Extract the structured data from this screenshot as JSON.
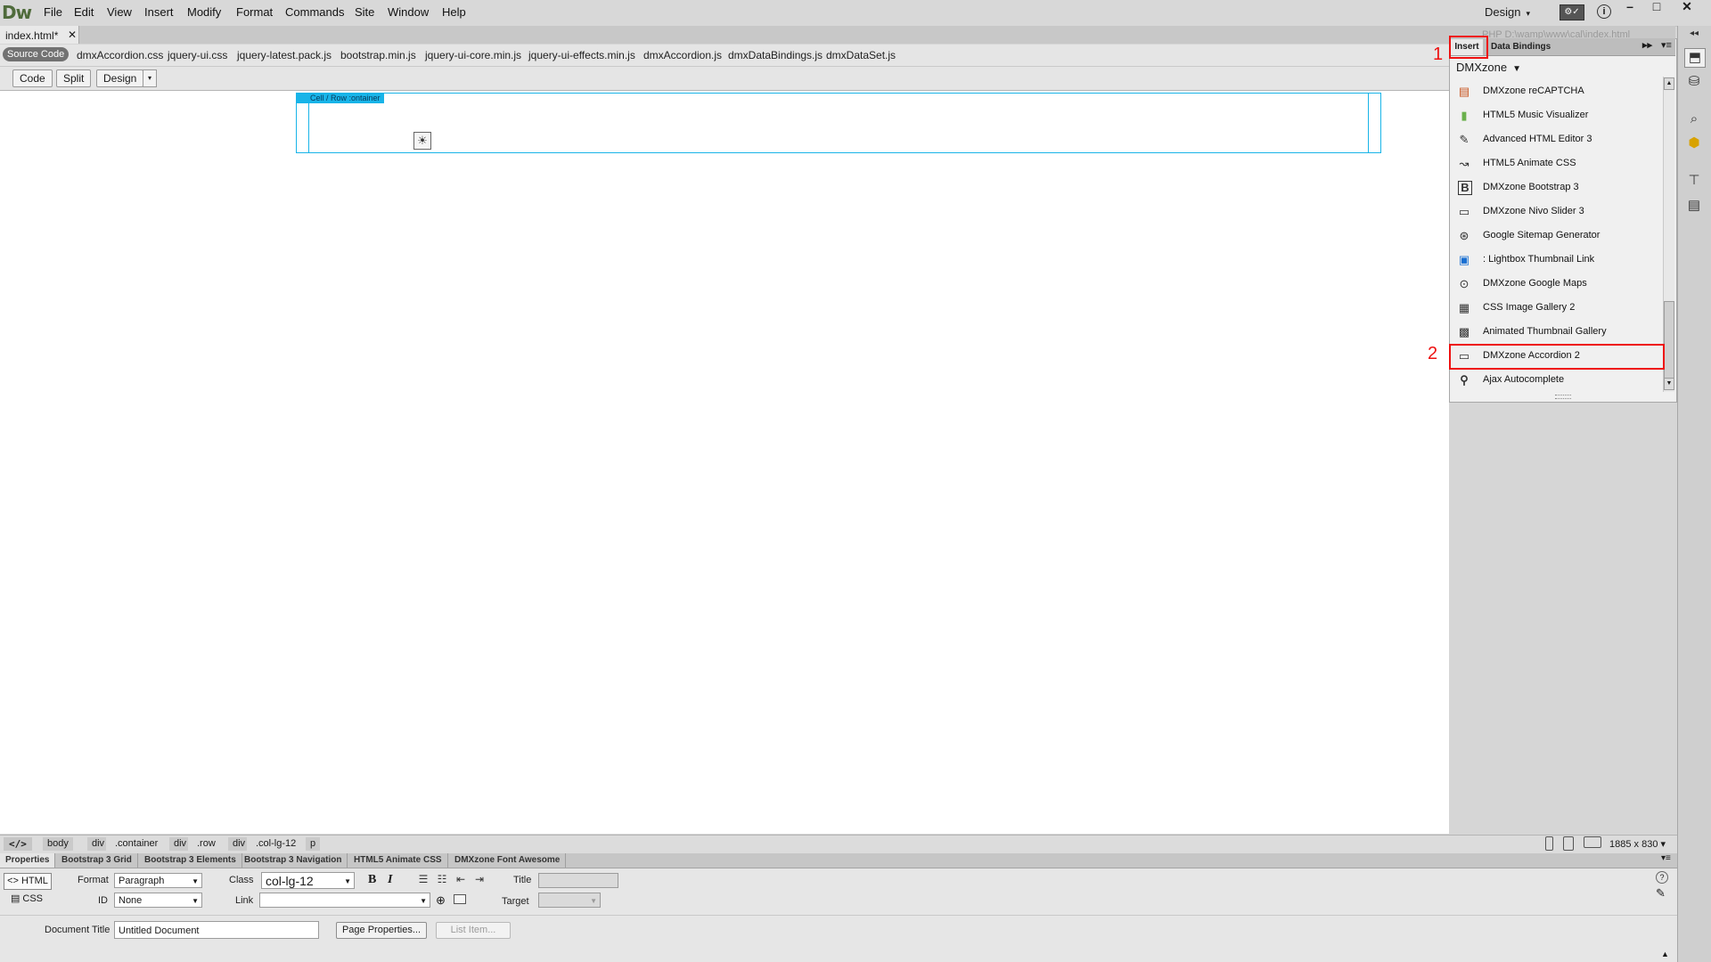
{
  "app": {
    "logo": "Dw"
  },
  "menu": [
    "File",
    "Edit",
    "View",
    "Insert",
    "Modify",
    "Format",
    "Commands",
    "Site",
    "Window",
    "Help"
  ],
  "workspace": {
    "label": "Design",
    "caret": "▾"
  },
  "window_controls": {
    "minimize": "–",
    "maximize": "□",
    "close": "✕"
  },
  "document_tab": {
    "label": "index.html*",
    "close": "✕"
  },
  "path_title": "PHP   D:\\wamp\\www\\cal\\index.html",
  "related_files": {
    "source_code": "Source Code",
    "files": [
      "dmxAccordion.css",
      "jquery-ui.css",
      "jquery-latest.pack.js",
      "bootstrap.min.js",
      "jquery-ui-core.min.js",
      "jquery-ui-effects.min.js",
      "dmxAccordion.js",
      "dmxDataBindings.js",
      "dmxDataSet.js"
    ]
  },
  "view_toolbar": {
    "code": "Code",
    "split": "Split",
    "design": "Design",
    "caret": "▾"
  },
  "canvas": {
    "cell_label": "Cell  / Row :ontainer",
    "placeholder_glyph": "☀"
  },
  "insert_panel": {
    "tabs": {
      "insert": "Insert",
      "data_bindings": "Data Bindings"
    },
    "arrows": "▸▸",
    "menu": "▾≡",
    "category": "DMXzone",
    "category_caret": "▼",
    "items": [
      {
        "label": "DMXzone reCAPTCHA",
        "icon": "recaptcha-icon",
        "glyph": "▤"
      },
      {
        "label": "HTML5 Music Visualizer",
        "icon": "music-visualizer-icon",
        "glyph": "▮"
      },
      {
        "label": "Advanced HTML Editor 3",
        "icon": "html-editor-icon",
        "glyph": "✎"
      },
      {
        "label": "HTML5 Animate CSS",
        "icon": "animate-css-icon",
        "glyph": "↝"
      },
      {
        "label": "DMXzone Bootstrap 3",
        "icon": "bootstrap-icon",
        "glyph": "B"
      },
      {
        "label": "DMXzone Nivo Slider 3",
        "icon": "nivo-slider-icon",
        "glyph": "▭"
      },
      {
        "label": "Google Sitemap Generator",
        "icon": "sitemap-generator-icon",
        "glyph": "⊛"
      },
      {
        "label": ": Lightbox Thumbnail Link",
        "icon": "lightbox-thumbnail-icon",
        "glyph": "▣"
      },
      {
        "label": "DMXzone Google Maps",
        "icon": "google-maps-icon",
        "glyph": "⊙"
      },
      {
        "label": "CSS Image Gallery 2",
        "icon": "image-gallery-icon",
        "glyph": "▦"
      },
      {
        "label": "Animated Thumbnail Gallery",
        "icon": "thumbnail-gallery-icon",
        "glyph": "▩"
      },
      {
        "label": "DMXzone Accordion 2",
        "icon": "accordion-icon",
        "glyph": "▭"
      },
      {
        "label": "Ajax Autocomplete",
        "icon": "autocomplete-search-icon",
        "glyph": "⚲"
      }
    ]
  },
  "annotations": [
    "1",
    "2"
  ],
  "tag_selector": {
    "code_tag": "</>",
    "tags": [
      "body",
      "div",
      ".container",
      "div",
      ".row",
      "div",
      ".col-lg-12",
      "p"
    ],
    "window_size": "1885 x 830 ▾"
  },
  "property_tabs": [
    "Properties",
    "Bootstrap 3 Grid",
    "Bootstrap 3 Elements",
    "Bootstrap 3 Navigation",
    "HTML5 Animate CSS",
    "DMXzone Font Awesome"
  ],
  "properties": {
    "html_button": "<> HTML",
    "css_button": "CSS",
    "format_label": "Format",
    "format_value": "Paragraph",
    "id_label": "ID",
    "id_value": "None",
    "class_label": "Class",
    "class_value": "col-lg-12",
    "link_label": "Link",
    "link_value": "",
    "bold": "B",
    "italic": "I",
    "title_label": "Title",
    "target_label": "Target",
    "document_title_label": "Document Title",
    "document_title_value": "Untitled Document",
    "page_properties_button": "Page Properties...",
    "list_item_button": "List Item..."
  },
  "colors": {
    "accent_selection": "#18b4e8",
    "annotation": "#e11111",
    "logo": "#4f6b3b"
  }
}
